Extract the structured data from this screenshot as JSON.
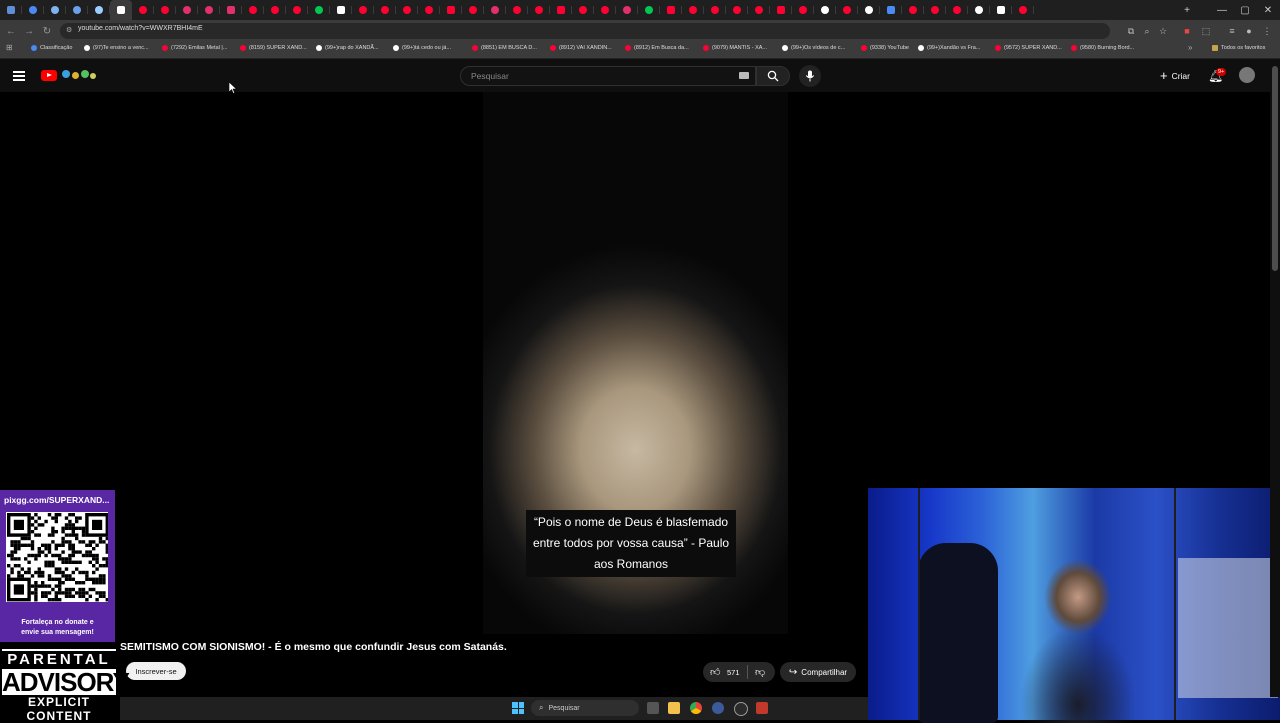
{
  "browser": {
    "url": "youtube.com/watch?v=WWXR7BHI4mE",
    "tabs": [
      {
        "color": "#5f8dd6"
      },
      {
        "color": "#4a8af4"
      },
      {
        "color": "#7fb2f0"
      },
      {
        "color": "#6aa0e8"
      },
      {
        "color": "#9ccfff"
      },
      {
        "color": "#ffffff",
        "active": true
      },
      {
        "color": "#ff0033"
      },
      {
        "color": "#ff0033"
      },
      {
        "color": "#e1306c"
      },
      {
        "color": "#e1306c"
      },
      {
        "color": "#e1306c"
      },
      {
        "color": "#ff0033"
      },
      {
        "color": "#ff0033"
      },
      {
        "color": "#ff0033"
      },
      {
        "color": "#00c853"
      },
      {
        "color": "#ffffff"
      },
      {
        "color": "#ff0033"
      },
      {
        "color": "#ff0033"
      },
      {
        "color": "#ff0033"
      },
      {
        "color": "#ff0033"
      },
      {
        "color": "#ff0033"
      },
      {
        "color": "#ff0033"
      },
      {
        "color": "#e1306c"
      },
      {
        "color": "#ff0033"
      },
      {
        "color": "#ff0033"
      },
      {
        "color": "#ff0033"
      },
      {
        "color": "#ff0033"
      },
      {
        "color": "#ff0033"
      },
      {
        "color": "#e1306c"
      },
      {
        "color": "#00c853"
      },
      {
        "color": "#ff0033"
      },
      {
        "color": "#ff0033"
      },
      {
        "color": "#ff0033"
      },
      {
        "color": "#ff0033"
      },
      {
        "color": "#ff0033"
      },
      {
        "color": "#ff0033"
      },
      {
        "color": "#ff0033"
      },
      {
        "color": "#ffffff"
      },
      {
        "color": "#ff0033"
      },
      {
        "color": "#ffffff"
      },
      {
        "color": "#4a8af4"
      },
      {
        "color": "#ff0033"
      },
      {
        "color": "#ff0033"
      },
      {
        "color": "#ff0033"
      },
      {
        "color": "#ffffff"
      },
      {
        "color": "#ffffff"
      },
      {
        "color": "#ff0033"
      }
    ],
    "bookmarks": [
      {
        "label": "Classificação",
        "color": "#4a8af4"
      },
      {
        "label": "(97)Te ensino a venc...",
        "color": "#ffffff"
      },
      {
        "label": "(7292) Emilas Metal |...",
        "color": "#ff0033"
      },
      {
        "label": "(8159) SUPER XAND...",
        "color": "#ff0033"
      },
      {
        "label": "(99+)rap do XANDÃ...",
        "color": "#ffffff"
      },
      {
        "label": "(99+)tá cedo ou já...",
        "color": "#ffffff"
      },
      {
        "label": "(8851) EM BUSCA D...",
        "color": "#ff0033"
      },
      {
        "label": "(8912) VAI XANDIN...",
        "color": "#ff0033"
      },
      {
        "label": "(8912) Em Busca da...",
        "color": "#ff0033"
      },
      {
        "label": "(9079) MANTIS - XA...",
        "color": "#ff0033"
      },
      {
        "label": "(99+)Os vídeos de c...",
        "color": "#ffffff"
      },
      {
        "label": "(9338) YouTube",
        "color": "#ff0033"
      },
      {
        "label": "(99+)Xandão vs Fra...",
        "color": "#ffffff"
      },
      {
        "label": "(9572) SUPER XAND...",
        "color": "#ff0033"
      },
      {
        "label": "(9580) Burning Bord...",
        "color": "#ff0033"
      }
    ],
    "all_bookmarks_label": "Todos os favoritos"
  },
  "youtube": {
    "search_placeholder": "Pesquisar",
    "create_label": "Criar",
    "notification_count": "9+",
    "video_title": "SEMITISMO COM SIONISMO! - É o mesmo que confundir Jesus com Satanás.",
    "subscribe_label": "Inscrever-se",
    "likes": "571",
    "share_label": "Compartilhar",
    "caption_lines": [
      "“Pois o nome de Deus é blasfemado",
      "entre todos por vossa causa” - Paulo",
      "aos Romanos"
    ]
  },
  "overlay": {
    "donate_url": "pixgg.com/SUPERXAND...",
    "donate_message_line1": "Fortaleça no donate e",
    "donate_message_line2": "envie sua mensagem!",
    "advisory_line1": "PARENTAL",
    "advisory_line2": "ADVISORY",
    "advisory_line3": "EXPLICIT CONTENT"
  },
  "taskbar": {
    "search_placeholder": "Pesquisar"
  }
}
